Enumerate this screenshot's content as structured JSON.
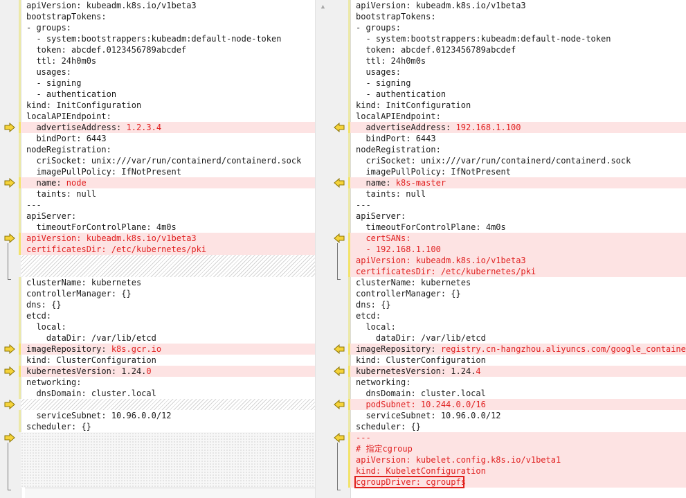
{
  "left_pane": {
    "lines": [
      {
        "row": 0,
        "prefix": "apiVersion: kubeadm.k8s.io/v1beta3",
        "value": "",
        "changed": false
      },
      {
        "row": 1,
        "prefix": "bootstrapTokens:",
        "value": "",
        "changed": false
      },
      {
        "row": 2,
        "prefix": "- groups:",
        "value": "",
        "changed": false
      },
      {
        "row": 3,
        "prefix": "  - system:bootstrappers:kubeadm:default-node-token",
        "value": "",
        "changed": false
      },
      {
        "row": 4,
        "prefix": "  token: abcdef.0123456789abcdef",
        "value": "",
        "changed": false
      },
      {
        "row": 5,
        "prefix": "  ttl: 24h0m0s",
        "value": "",
        "changed": false
      },
      {
        "row": 6,
        "prefix": "  usages:",
        "value": "",
        "changed": false
      },
      {
        "row": 7,
        "prefix": "  - signing",
        "value": "",
        "changed": false
      },
      {
        "row": 8,
        "prefix": "  - authentication",
        "value": "",
        "changed": false
      },
      {
        "row": 9,
        "prefix": "kind: InitConfiguration",
        "value": "",
        "changed": false
      },
      {
        "row": 10,
        "prefix": "localAPIEndpoint:",
        "value": "",
        "changed": false
      },
      {
        "row": 11,
        "prefix": "  advertiseAddress: ",
        "value": "1.2.3.4",
        "changed": true
      },
      {
        "row": 12,
        "prefix": "  bindPort: 6443",
        "value": "",
        "changed": false
      },
      {
        "row": 13,
        "prefix": "nodeRegistration:",
        "value": "",
        "changed": false
      },
      {
        "row": 14,
        "prefix": "  criSocket: unix:///var/run/containerd/containerd.sock",
        "value": "",
        "changed": false
      },
      {
        "row": 15,
        "prefix": "  imagePullPolicy: IfNotPresent",
        "value": "",
        "changed": false
      },
      {
        "row": 16,
        "prefix": "  name: ",
        "value": "node",
        "changed": true
      },
      {
        "row": 17,
        "prefix": "  taints: null",
        "value": "",
        "changed": false
      },
      {
        "row": 18,
        "prefix": "---",
        "value": "",
        "changed": false
      },
      {
        "row": 19,
        "prefix": "apiServer:",
        "value": "",
        "changed": false
      },
      {
        "row": 20,
        "prefix": "  timeoutForControlPlane: 4m0s",
        "value": "",
        "changed": false
      },
      {
        "row": 21,
        "prefix": "",
        "value": "apiVersion: kubeadm.k8s.io/v1beta3",
        "changed": true
      },
      {
        "row": 22,
        "prefix": "",
        "value": "certificatesDir: /etc/kubernetes/pki",
        "changed": true
      },
      {
        "row": 25,
        "prefix": "clusterName: kubernetes",
        "value": "",
        "changed": false
      },
      {
        "row": 26,
        "prefix": "controllerManager: {}",
        "value": "",
        "changed": false
      },
      {
        "row": 27,
        "prefix": "dns: {}",
        "value": "",
        "changed": false
      },
      {
        "row": 28,
        "prefix": "etcd:",
        "value": "",
        "changed": false
      },
      {
        "row": 29,
        "prefix": "  local:",
        "value": "",
        "changed": false
      },
      {
        "row": 30,
        "prefix": "    dataDir: /var/lib/etcd",
        "value": "",
        "changed": false
      },
      {
        "row": 31,
        "prefix": "imageRepository: ",
        "value": "k8s.gcr.io",
        "changed": true
      },
      {
        "row": 32,
        "prefix": "kind: ClusterConfiguration",
        "value": "",
        "changed": false
      },
      {
        "row": 33,
        "prefix": "kubernetesVersion: 1.24.",
        "value": "0",
        "changed": true
      },
      {
        "row": 34,
        "prefix": "networking:",
        "value": "",
        "changed": false
      },
      {
        "row": 35,
        "prefix": "  dnsDomain: cluster.local",
        "value": "",
        "changed": false
      },
      {
        "row": 37,
        "prefix": "  serviceSubnet: 10.96.0.0/12",
        "value": "",
        "changed": false
      },
      {
        "row": 38,
        "prefix": "scheduler: {}",
        "value": "",
        "changed": false
      }
    ]
  },
  "right_pane": {
    "lines": [
      {
        "row": 0,
        "prefix": "apiVersion: kubeadm.k8s.io/v1beta3",
        "value": "",
        "changed": false
      },
      {
        "row": 1,
        "prefix": "bootstrapTokens:",
        "value": "",
        "changed": false
      },
      {
        "row": 2,
        "prefix": "- groups:",
        "value": "",
        "changed": false
      },
      {
        "row": 3,
        "prefix": "  - system:bootstrappers:kubeadm:default-node-token",
        "value": "",
        "changed": false
      },
      {
        "row": 4,
        "prefix": "  token: abcdef.0123456789abcdef",
        "value": "",
        "changed": false
      },
      {
        "row": 5,
        "prefix": "  ttl: 24h0m0s",
        "value": "",
        "changed": false
      },
      {
        "row": 6,
        "prefix": "  usages:",
        "value": "",
        "changed": false
      },
      {
        "row": 7,
        "prefix": "  - signing",
        "value": "",
        "changed": false
      },
      {
        "row": 8,
        "prefix": "  - authentication",
        "value": "",
        "changed": false
      },
      {
        "row": 9,
        "prefix": "kind: InitConfiguration",
        "value": "",
        "changed": false
      },
      {
        "row": 10,
        "prefix": "localAPIEndpoint:",
        "value": "",
        "changed": false
      },
      {
        "row": 11,
        "prefix": "  advertiseAddress: ",
        "value": "192.168.1.100",
        "changed": true
      },
      {
        "row": 12,
        "prefix": "  bindPort: 6443",
        "value": "",
        "changed": false
      },
      {
        "row": 13,
        "prefix": "nodeRegistration:",
        "value": "",
        "changed": false
      },
      {
        "row": 14,
        "prefix": "  criSocket: unix:///var/run/containerd/containerd.sock",
        "value": "",
        "changed": false
      },
      {
        "row": 15,
        "prefix": "  imagePullPolicy: IfNotPresent",
        "value": "",
        "changed": false
      },
      {
        "row": 16,
        "prefix": "  name: ",
        "value": "k8s-master",
        "changed": true
      },
      {
        "row": 17,
        "prefix": "  taints: null",
        "value": "",
        "changed": false
      },
      {
        "row": 18,
        "prefix": "---",
        "value": "",
        "changed": false
      },
      {
        "row": 19,
        "prefix": "apiServer:",
        "value": "",
        "changed": false
      },
      {
        "row": 20,
        "prefix": "  timeoutForControlPlane: 4m0s",
        "value": "",
        "changed": false
      },
      {
        "row": 21,
        "prefix": "",
        "value": "  certSANs:",
        "changed": true
      },
      {
        "row": 22,
        "prefix": "",
        "value": "  - 192.168.1.100",
        "changed": true
      },
      {
        "row": 23,
        "prefix": "",
        "value": "apiVersion: kubeadm.k8s.io/v1beta3",
        "changed": true
      },
      {
        "row": 24,
        "prefix": "",
        "value": "certificatesDir: /etc/kubernetes/pki",
        "changed": true
      },
      {
        "row": 25,
        "prefix": "clusterName: kubernetes",
        "value": "",
        "changed": false
      },
      {
        "row": 26,
        "prefix": "controllerManager: {}",
        "value": "",
        "changed": false
      },
      {
        "row": 27,
        "prefix": "dns: {}",
        "value": "",
        "changed": false
      },
      {
        "row": 28,
        "prefix": "etcd:",
        "value": "",
        "changed": false
      },
      {
        "row": 29,
        "prefix": "  local:",
        "value": "",
        "changed": false
      },
      {
        "row": 30,
        "prefix": "    dataDir: /var/lib/etcd",
        "value": "",
        "changed": false
      },
      {
        "row": 31,
        "prefix": "imageRepository: ",
        "value": "registry.cn-hangzhou.aliyuncs.com/google_containers",
        "changed": true
      },
      {
        "row": 32,
        "prefix": "kind: ClusterConfiguration",
        "value": "",
        "changed": false
      },
      {
        "row": 33,
        "prefix": "kubernetesVersion: 1.24.",
        "value": "4",
        "changed": true
      },
      {
        "row": 34,
        "prefix": "networking:",
        "value": "",
        "changed": false
      },
      {
        "row": 35,
        "prefix": "  dnsDomain: cluster.local",
        "value": "",
        "changed": false
      },
      {
        "row": 36,
        "prefix": "",
        "value": "  podSubnet: 10.244.0.0/16",
        "changed": true
      },
      {
        "row": 37,
        "prefix": "  serviceSubnet: 10.96.0.0/12",
        "value": "",
        "changed": false
      },
      {
        "row": 38,
        "prefix": "scheduler: {}",
        "value": "",
        "changed": false
      },
      {
        "row": 39,
        "prefix": "",
        "value": "---",
        "changed": true
      },
      {
        "row": 40,
        "prefix": "",
        "value": "# 指定cgroup",
        "changed": true
      },
      {
        "row": 41,
        "prefix": "",
        "value": "apiVersion: kubelet.config.k8s.io/v1beta1",
        "changed": true
      },
      {
        "row": 42,
        "prefix": "",
        "value": "kind: KubeletConfiguration",
        "changed": true
      },
      {
        "row": 43,
        "prefix": "",
        "value": "cgroupDriver: cgroupfs",
        "changed": true,
        "boxed": true
      }
    ]
  },
  "colors": {
    "changed_bg": "#fde3e3",
    "changed_text": "#e02020",
    "arrow_fill": "#f5d33a",
    "highlight_box": "#e0201c"
  },
  "icons": {
    "left_arrow": "right-arrow-icon",
    "right_arrow": "left-arrow-icon",
    "scroll_up": "scroll-up-icon"
  }
}
